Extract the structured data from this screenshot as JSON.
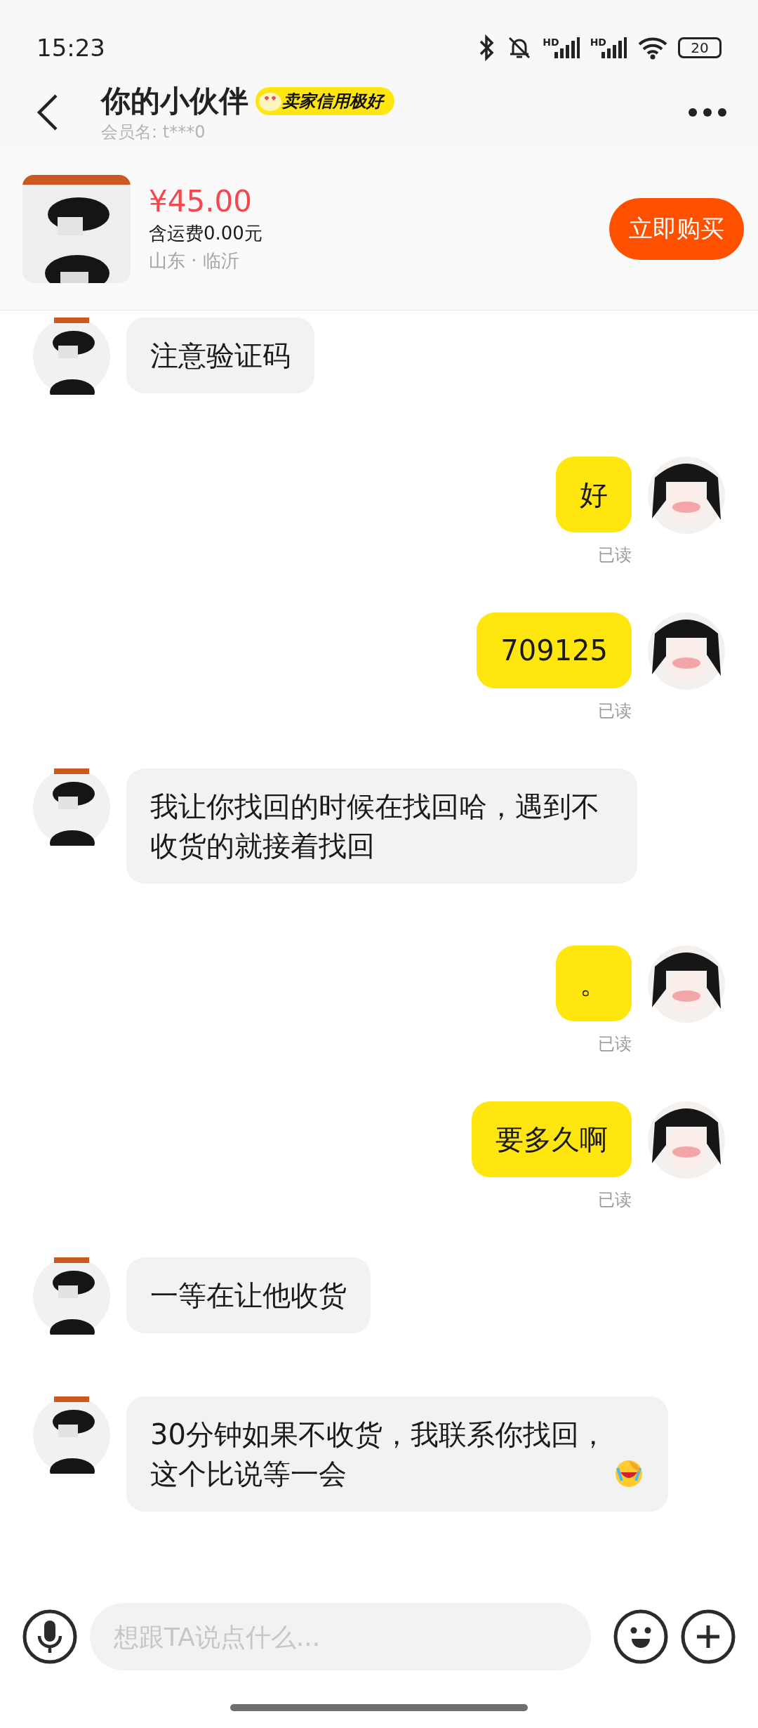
{
  "status_bar": {
    "time": "15:23",
    "signal_labels": [
      "HD",
      "HD"
    ],
    "battery": "20"
  },
  "header": {
    "title": "你的小伙伴",
    "badge": "卖家信用极好",
    "subtitle": "会员名: t***0"
  },
  "product": {
    "price": "¥45.00",
    "shipping": "含运费0.00元",
    "location": "山东 · 临沂",
    "buy_button": "立即购买"
  },
  "messages": [
    {
      "kind": "received",
      "text": "注意验证码",
      "emoji": false
    },
    {
      "kind": "sent",
      "text": "好",
      "read": "已读",
      "emoji": false
    },
    {
      "kind": "sent",
      "text": "709125",
      "read": "已读",
      "emoji": false
    },
    {
      "kind": "received",
      "text": "我让你找回的时候在找回哈，遇到不收货的就接着找回",
      "emoji": false
    },
    {
      "kind": "sent",
      "text": "。",
      "read": "已读",
      "emoji": false
    },
    {
      "kind": "sent",
      "text": "要多久啊",
      "read": "已读",
      "emoji": false
    },
    {
      "kind": "received",
      "text": "一等在让他收货",
      "emoji": false
    },
    {
      "kind": "received",
      "text": "30分钟如果不收货，我联系你找回，这个比说等一会",
      "emoji": true
    }
  ],
  "input_bar": {
    "placeholder": "想跟TA说点什么..."
  }
}
